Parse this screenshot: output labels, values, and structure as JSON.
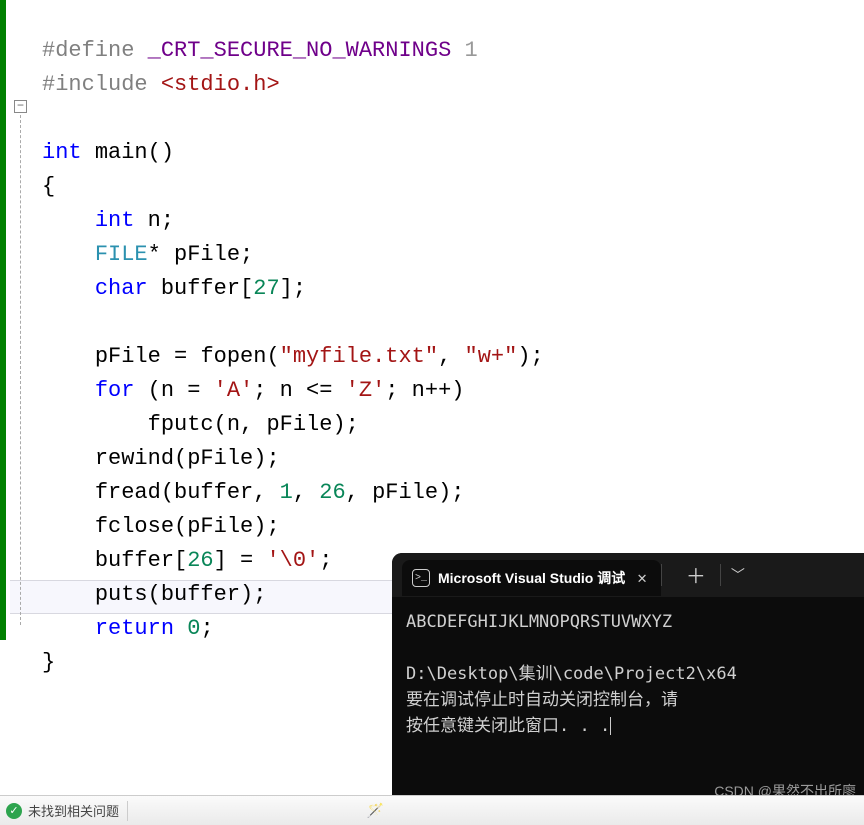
{
  "code": {
    "l1_define": "#define",
    "l1_macro": "_CRT_SECURE_NO_WARNINGS",
    "l1_val": "1",
    "l2_include": "#include",
    "l2_hdr": "<stdio.h>",
    "l4_int": "int",
    "l4_main": "main",
    "l4_paren": "()",
    "l5_brace": "{",
    "l6_int": "int",
    "l6_n": "n;",
    "l7_FILE": "FILE",
    "l7_star": "*",
    "l7_pFile": "pFile;",
    "l8_char": "char",
    "l8_buffer": "buffer",
    "l8_idx": "[",
    "l8_27": "27",
    "l8_idx2": "];",
    "l10_pFile": "pFile",
    "l10_eq": " = ",
    "l10_fopen": "fopen",
    "l10_p1": "(",
    "l10_s1": "\"myfile.txt\"",
    "l10_c": ", ",
    "l10_s2": "\"w+\"",
    "l10_p2": ");",
    "l11_for": "for",
    "l11_p1": " (n = ",
    "l11_A": "'A'",
    "l11_mid": "; n <= ",
    "l11_Z": "'Z'",
    "l11_end": "; n++)",
    "l12_fputc": "fputc",
    "l12_args": "(n, pFile);",
    "l13_rewind": "rewind",
    "l13_args": "(pFile);",
    "l14_fread": "fread",
    "l14_p1": "(buffer, ",
    "l14_1": "1",
    "l14_c": ", ",
    "l14_26": "26",
    "l14_p2": ", pFile);",
    "l15_fclose": "fclose",
    "l15_args": "(pFile);",
    "l16_buffer": "buffer",
    "l16_b1": "[",
    "l16_26": "26",
    "l16_b2": "] = ",
    "l16_nul": "'\\0'",
    "l16_sc": ";",
    "l17_puts": "puts",
    "l17_args": "(buffer);",
    "l18_return": "return",
    "l18_sp": " ",
    "l18_0": "0",
    "l18_sc": ";",
    "l19_brace": "}"
  },
  "console": {
    "tab_title": "Microsoft Visual Studio 调试",
    "line1": "ABCDEFGHIJKLMNOPQRSTUVWXYZ",
    "line2": "",
    "line3": "D:\\Desktop\\集训\\code\\Project2\\x64",
    "line4": "要在调试停止时自动关闭控制台，请",
    "line5": "按任意键关闭此窗口. . .",
    "watermark": "CSDN @果然不出所廖"
  },
  "status": {
    "noissues": "未找到相关问题"
  }
}
